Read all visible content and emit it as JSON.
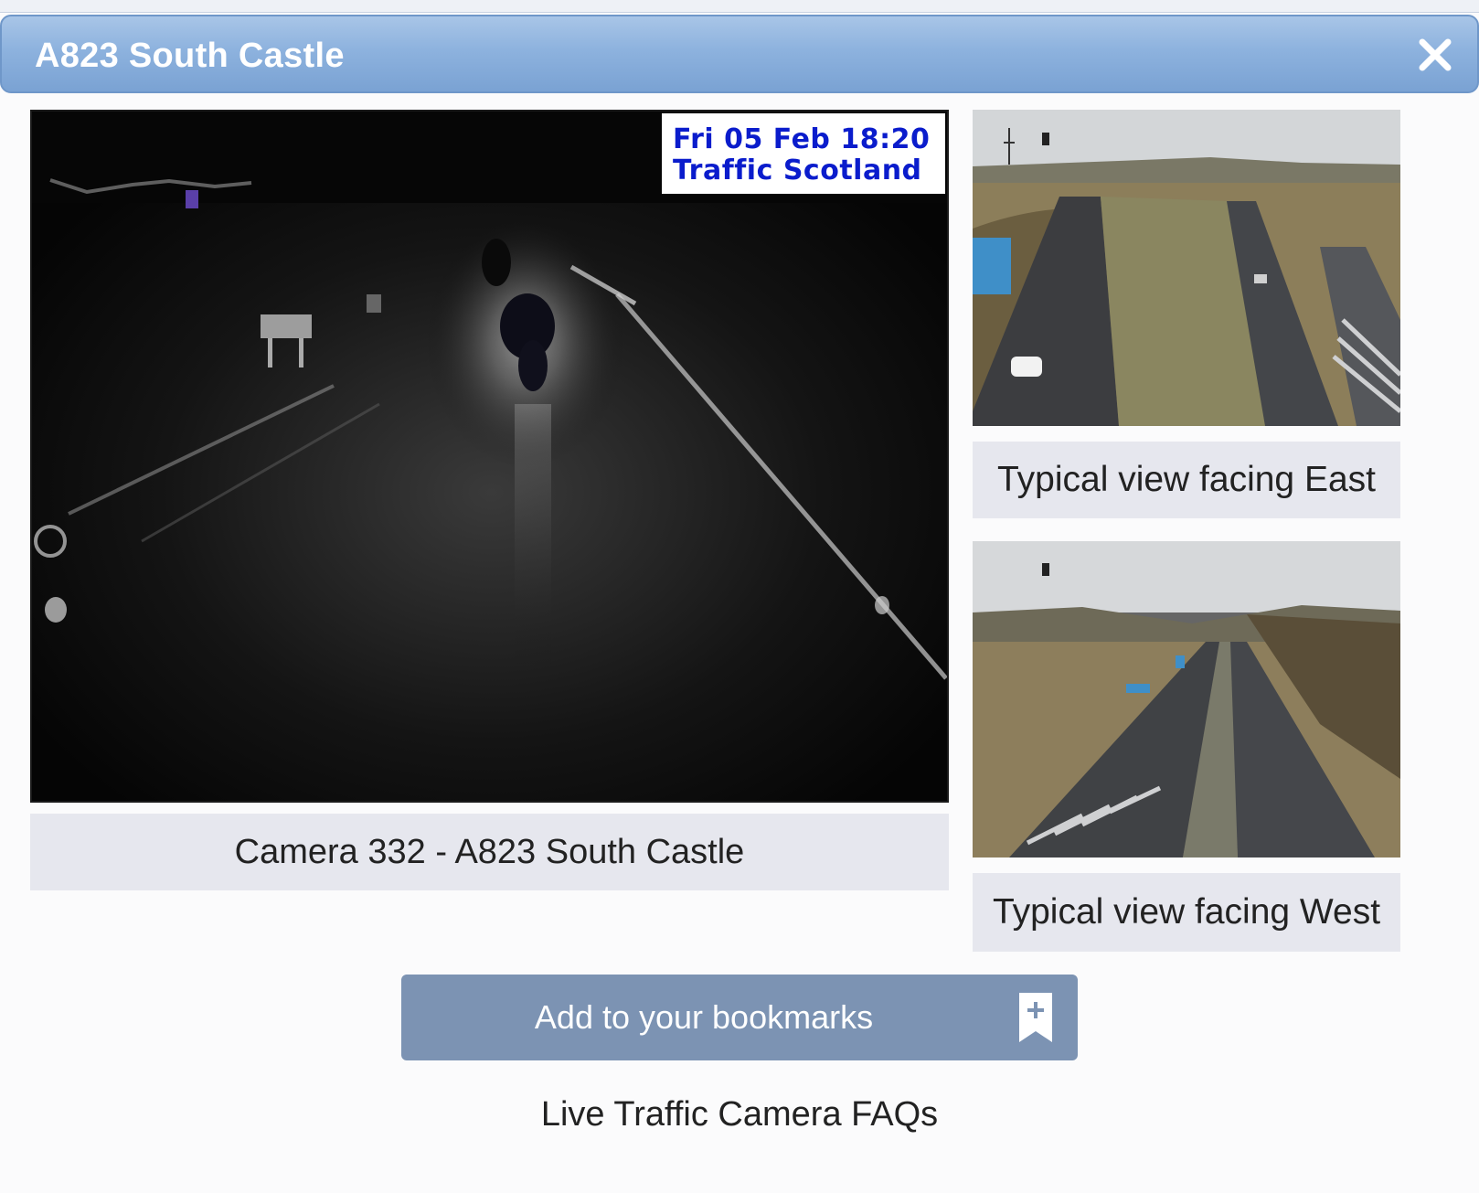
{
  "dialog": {
    "title": "A823 South Castle",
    "close_icon": "close-icon"
  },
  "main_camera": {
    "stamp_line1": "Fri 05 Feb 18:20",
    "stamp_line2": "Traffic Scotland",
    "caption": "Camera 332 - A823 South Castle"
  },
  "typical_views": {
    "east_caption": "Typical view facing East",
    "west_caption": "Typical view facing West"
  },
  "bookmark": {
    "label": "Add to your bookmarks",
    "icon": "bookmark-add-icon"
  },
  "faq_link": "Live Traffic Camera FAQs",
  "colors": {
    "titlebar": "#8db2de",
    "button": "#7c93b3",
    "caption_bg": "#e6e7ee",
    "stamp_text": "#0a1ccc"
  }
}
